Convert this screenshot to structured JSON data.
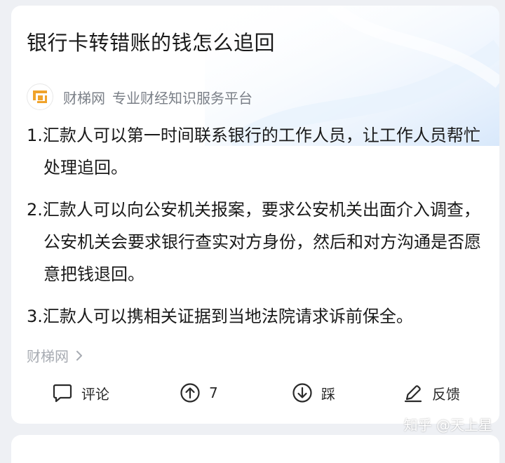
{
  "question": {
    "title": "银行卡转错账的钱怎么追回"
  },
  "source": {
    "name": "财梯网",
    "description": "专业财经知识服务平台",
    "logo_color": "#f0a32b"
  },
  "answer": {
    "paragraphs": [
      "1.汇款人可以第一时间联系银行的工作人员，让工作人员帮忙处理追回。",
      "2.汇款人可以向公安机关报案，要求公安机关出面介入调查，公安机关会要求银行查实对方身份，然后和对方沟通是否愿意把钱退回。",
      "3.汇款人可以携相关证据到当地法院请求诉前保全。"
    ]
  },
  "footer": {
    "more_link": "财梯网"
  },
  "actions": {
    "comment_label": "评论",
    "upvote_count": "7",
    "downvote_label": "踩",
    "feedback_label": "反馈"
  },
  "watermark": {
    "text": "知乎 @天上星"
  }
}
